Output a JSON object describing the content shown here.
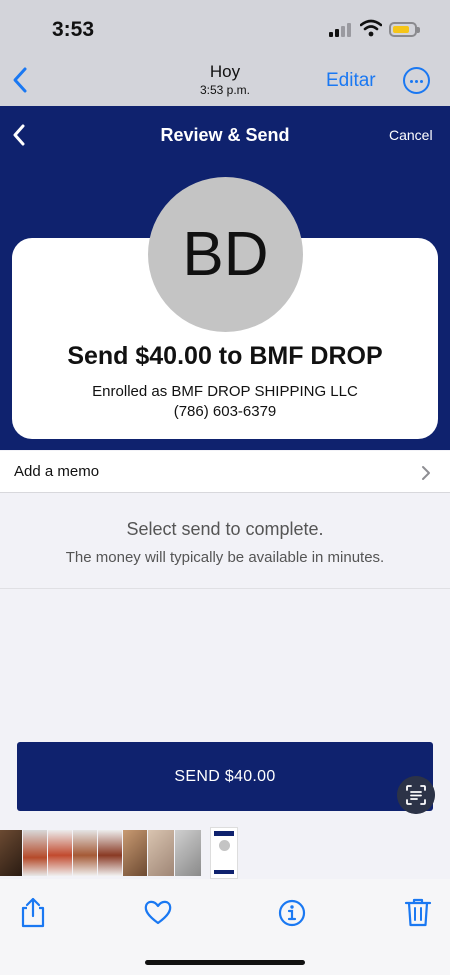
{
  "status_bar": {
    "time": "3:53",
    "battery_color": "#f5c518"
  },
  "photos_nav": {
    "back_icon": "chevron-left-icon",
    "title": "Hoy",
    "subtitle": "3:53 p.m.",
    "edit_label": "Editar",
    "more_icon": "ellipsis-circle-icon",
    "accent_color": "#1a78f2"
  },
  "app_header": {
    "back_icon": "chevron-left-icon",
    "title": "Review & Send",
    "cancel_label": "Cancel",
    "brand_color": "#0f226e"
  },
  "recipient": {
    "initials": "BD",
    "headline": "Send $40.00 to BMF DROP",
    "enrolled_as": "Enrolled as BMF DROP SHIPPING LLC",
    "phone": "(786) 603-6379"
  },
  "memo": {
    "label": "Add a memo",
    "chevron_icon": "chevron-right-icon"
  },
  "info": {
    "complete": "Select send to complete.",
    "available": "The money will typically be available in minutes."
  },
  "send_button": {
    "label": "SEND $40.00"
  },
  "toolbar": {
    "icons": [
      "share-icon",
      "heart-icon",
      "info-icon",
      "trash-icon"
    ]
  }
}
